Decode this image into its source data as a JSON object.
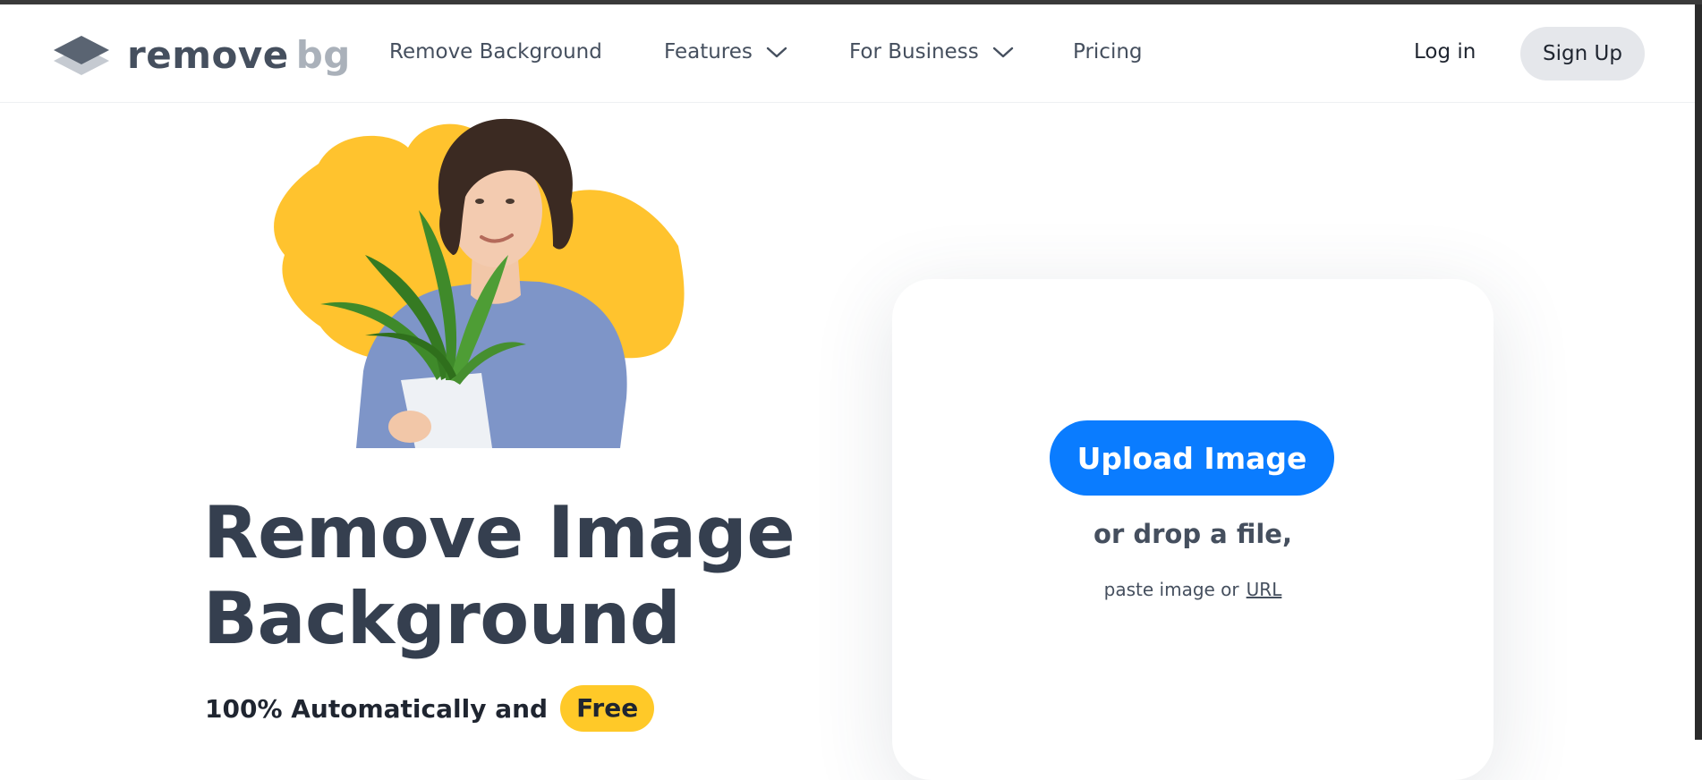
{
  "brand": {
    "name_part1": "remove",
    "name_part2": "bg"
  },
  "nav": {
    "items": [
      {
        "label": "Remove Background"
      },
      {
        "label": "Features"
      },
      {
        "label": "For Business"
      },
      {
        "label": "Pricing"
      }
    ],
    "login_label": "Log in",
    "signup_label": "Sign Up"
  },
  "hero": {
    "title_line1": "Remove Image",
    "title_line2": "Background",
    "subtitle": "100% Automatically and",
    "badge": "Free",
    "badge_color": "#ffc928"
  },
  "upload": {
    "button_label": "Upload Image",
    "button_color": "#0a7cff",
    "drop_text": "or drop a file,",
    "paste_text": "paste image or",
    "url_label": "URL"
  },
  "colors": {
    "text": "#454f5e",
    "heading": "#353f4f",
    "accent_yellow": "#ffc928"
  }
}
